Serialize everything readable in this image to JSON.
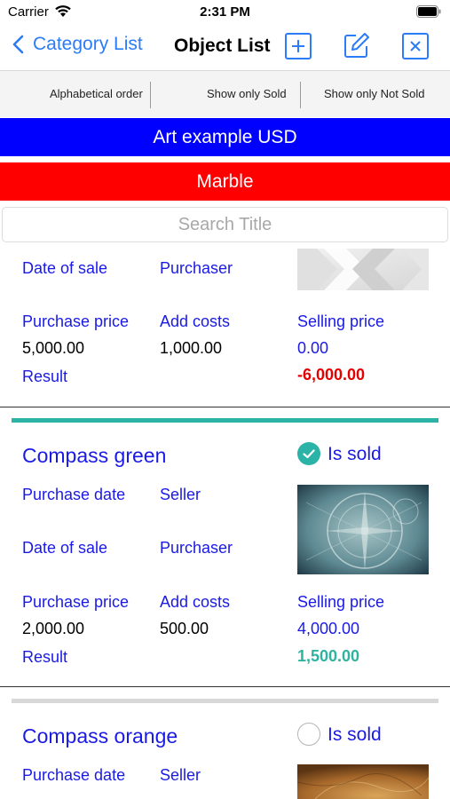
{
  "status_bar": {
    "carrier": "Carrier",
    "time": "2:31 PM"
  },
  "nav": {
    "back_label": "Category List",
    "title": "Object List"
  },
  "segments": [
    "Alphabetical order",
    "Show only Sold",
    "Show only Not Sold"
  ],
  "banners": {
    "collection": {
      "label": "Art example USD",
      "color": "#0000ff"
    },
    "category": {
      "label": "Marble",
      "color": "#ff0000"
    }
  },
  "search": {
    "placeholder": "Search Title",
    "value": ""
  },
  "labels": {
    "purchase_date": "Purchase date",
    "seller": "Seller",
    "date_of_sale": "Date of sale",
    "purchaser": "Purchaser",
    "purchase_price": "Purchase price",
    "add_costs": "Add costs",
    "selling_price": "Selling price",
    "result": "Result",
    "is_sold": "Is sold"
  },
  "items": [
    {
      "purchase_price": "5,000.00",
      "add_costs": "1,000.00",
      "selling_price": "0.00",
      "result": "-6,000.00",
      "result_color": "#e60000"
    },
    {
      "title": "Compass green",
      "is_sold": true,
      "bar_color": "#2bb3a7",
      "purchase_price": "2,000.00",
      "add_costs": "500.00",
      "selling_price": "4,000.00",
      "result": "1,500.00",
      "result_color": "#2db3a0"
    },
    {
      "title": "Compass orange",
      "is_sold": false,
      "bar_color": "#d8d8d8"
    }
  ]
}
